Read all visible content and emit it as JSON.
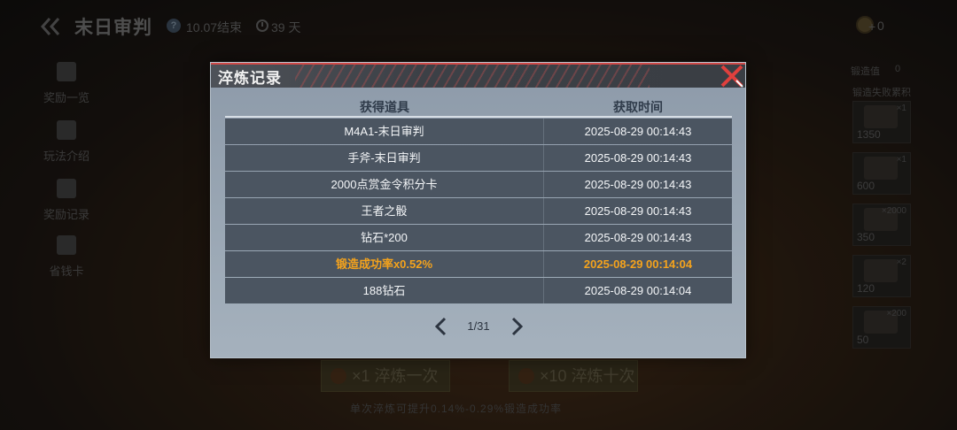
{
  "header": {
    "title": "末日审判",
    "help_icon": "question-mark-icon",
    "end_date": "10.07结束",
    "days_left": "39 天",
    "coin_plus": "+",
    "coin_count": "0"
  },
  "left_nav": [
    {
      "label": "奖励一览",
      "icon": "gift-icon"
    },
    {
      "label": "玩法介绍",
      "icon": "hammer-icon"
    },
    {
      "label": "奖励记录",
      "icon": "document-icon"
    },
    {
      "label": "省钱卡",
      "icon": "card-icon"
    }
  ],
  "right_panel": {
    "header_label": "锻造值",
    "header_value": "0",
    "subheader": "锻造失败累积",
    "items": [
      {
        "mult": "×1",
        "price": "1350"
      },
      {
        "mult": "×1",
        "price": "600"
      },
      {
        "mult": "×2000",
        "price": "350"
      },
      {
        "mult": "×2",
        "price": "120"
      },
      {
        "mult": "×200",
        "price": "50"
      }
    ]
  },
  "bottom": {
    "once_qty": "×1",
    "once_label": "淬炼一次",
    "ten_qty": "×10",
    "ten_label": "淬炼十次",
    "hint": "单次淬炼可提升0.14%-0.29%锻造成功率"
  },
  "modal": {
    "title": "淬炼记录",
    "columns": {
      "item": "获得道具",
      "time": "获取时间"
    },
    "rows": [
      {
        "item": "M4A1-末日审判",
        "time": "2025-08-29 00:14:43",
        "highlight": false
      },
      {
        "item": "手斧-末日审判",
        "time": "2025-08-29 00:14:43",
        "highlight": false
      },
      {
        "item": "2000点赏金令积分卡",
        "time": "2025-08-29 00:14:43",
        "highlight": false
      },
      {
        "item": "王者之骰",
        "time": "2025-08-29 00:14:43",
        "highlight": false
      },
      {
        "item": "钻石*200",
        "time": "2025-08-29 00:14:43",
        "highlight": false
      },
      {
        "item": "锻造成功率x0.52%",
        "time": "2025-08-29 00:14:04",
        "highlight": true
      },
      {
        "item": "188钻石",
        "time": "2025-08-29 00:14:04",
        "highlight": false
      }
    ],
    "page": "1/31",
    "highlight_color": "#f5a31c"
  }
}
